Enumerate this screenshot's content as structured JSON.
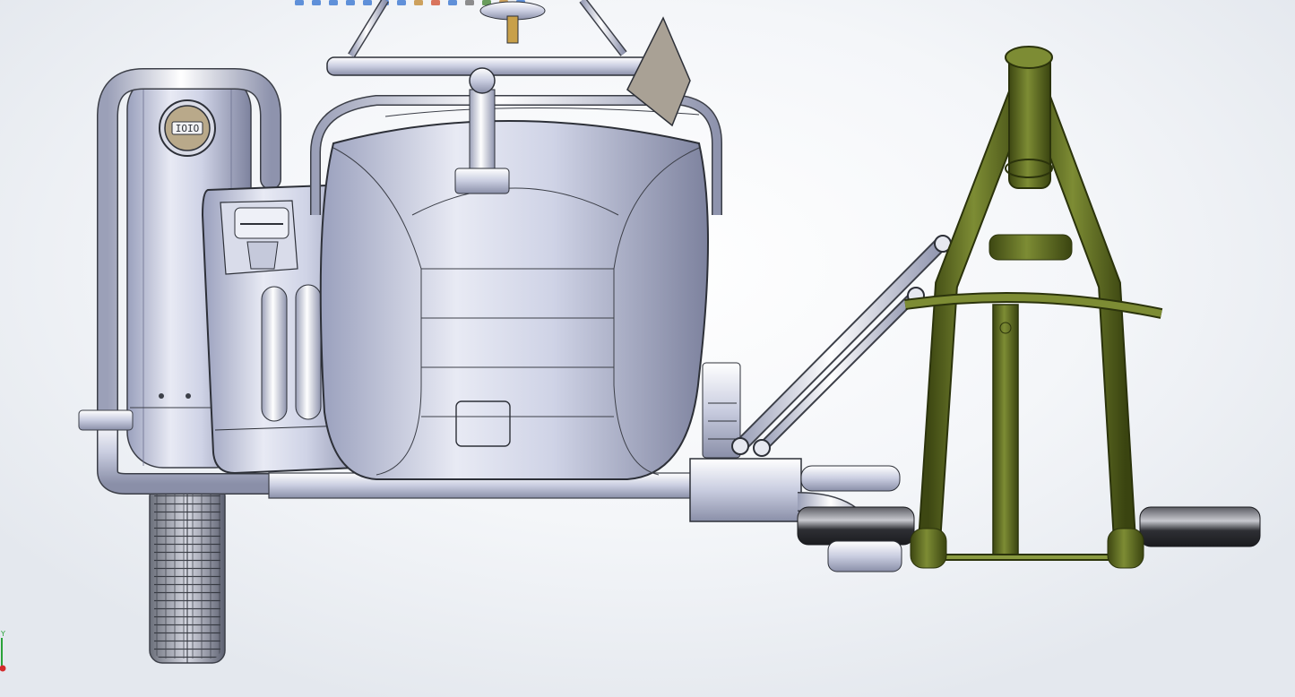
{
  "window": {
    "title": ""
  },
  "viewport": {
    "background_top": "#ffffff",
    "background_edge": "#e4e8ee"
  },
  "heads_up_toolbar": {
    "tools": [
      {
        "name": "zoom-to-fit-icon",
        "color": "#2f6fcf"
      },
      {
        "name": "zoom-to-area-icon",
        "color": "#2f6fcf"
      },
      {
        "name": "previous-view-icon",
        "color": "#2f6fcf"
      },
      {
        "name": "section-view-icon",
        "color": "#2f6fcf"
      },
      {
        "name": "dynamic-annotation-icon",
        "color": "#2f6fcf"
      },
      {
        "name": "view-orientation-icon",
        "color": "#2f6fcf"
      },
      {
        "name": "display-style-icon",
        "color": "#2f6fcf"
      },
      {
        "name": "hide-show-items-icon",
        "color": "#c0852a"
      },
      {
        "name": "edit-appearance-icon",
        "color": "#d04a2a"
      },
      {
        "name": "apply-scene-icon",
        "color": "#2f6fcf"
      },
      {
        "name": "view-settings-icon",
        "color": "#6a6a6a"
      },
      {
        "name": "rotate-view-icon",
        "color": "#3b7d2a"
      },
      {
        "name": "pan-icon",
        "color": "#c0852a"
      },
      {
        "name": "measure-icon",
        "color": "#2f6fcf"
      }
    ]
  },
  "model": {
    "frame_color": "#5c6b1f",
    "body_color": "#c6cbe0",
    "tire_color": "#7a7e88",
    "muffler_color": "#3a3b40",
    "jerrycan_cap_text": "",
    "gauge_text": "ΙOIΟ"
  },
  "triad": {
    "y_axis_label": "Y",
    "y_color": "#2aa33a",
    "origin_color": "#d42a2a"
  }
}
